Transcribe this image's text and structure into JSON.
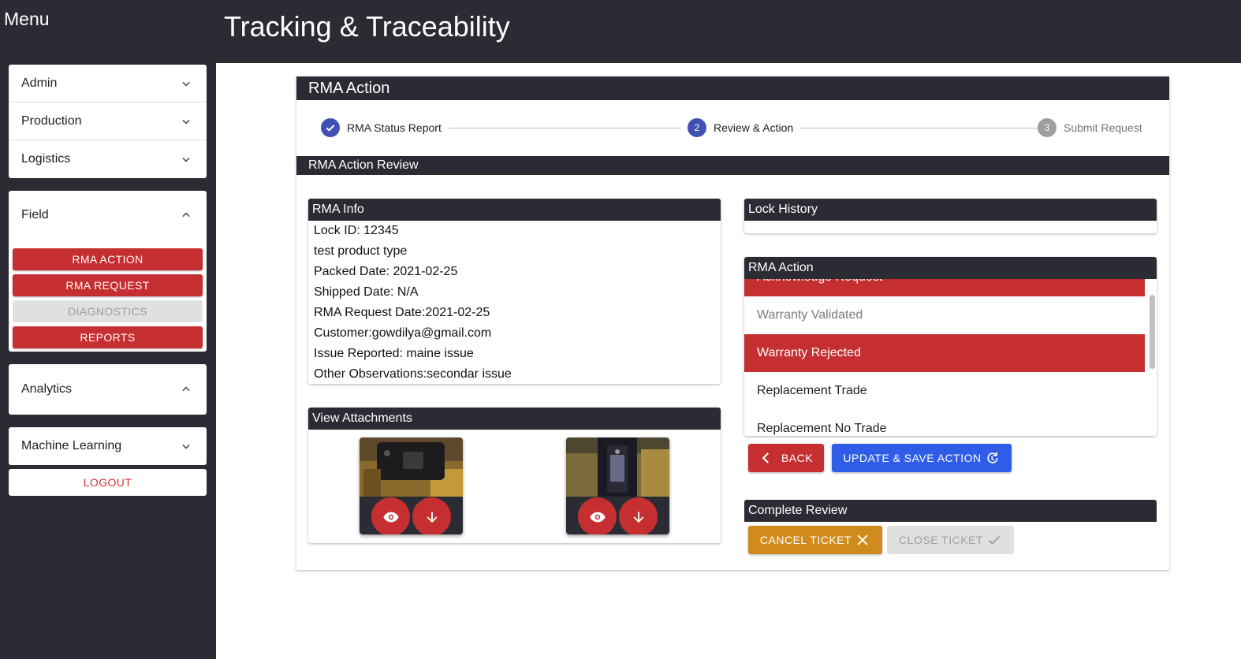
{
  "sidebar": {
    "title": "Menu",
    "groups": [
      {
        "label": "Admin"
      },
      {
        "label": "Production"
      },
      {
        "label": "Logistics"
      }
    ],
    "field": {
      "label": "Field",
      "items": [
        {
          "label": "RMA ACTION"
        },
        {
          "label": "RMA REQUEST"
        },
        {
          "label": "DIAGNOSTICS"
        },
        {
          "label": "REPORTS"
        }
      ]
    },
    "analytics": {
      "label": "Analytics"
    },
    "ml": {
      "label": "Machine Learning"
    },
    "logout": "LOGOUT"
  },
  "header": {
    "title": "Tracking & Traceability"
  },
  "panel": {
    "title": "RMA Action",
    "steps": [
      {
        "number": "1",
        "label": "RMA Status Report",
        "state": "done"
      },
      {
        "number": "2",
        "label": "Review & Action",
        "state": "active"
      },
      {
        "number": "3",
        "label": "Submit Request",
        "state": "pending"
      }
    ],
    "review_title": "RMA Action Review",
    "rma_info": {
      "title": "RMA Info",
      "lines": [
        "Lock ID: 12345",
        "test product type",
        "Packed Date: 2021-02-25",
        "Shipped Date: N/A",
        "RMA Request Date:2021-02-25",
        "Customer:gowdilya@gmail.com",
        "Issue Reported: maine issue",
        "Other Observations:secondar issue"
      ]
    },
    "attachments": {
      "title": "View Attachments"
    },
    "lock_history": {
      "title": "Lock History"
    },
    "rma_action": {
      "title": "RMA Action",
      "options": [
        {
          "label": "Acknowledge Request"
        },
        {
          "label": "Warranty Validated"
        },
        {
          "label": "Warranty Rejected"
        },
        {
          "label": "Replacement Trade"
        },
        {
          "label": "Replacement No Trade"
        }
      ],
      "back_label": "BACK",
      "update_label": "UPDATE & SAVE ACTION"
    },
    "complete_review": {
      "title": "Complete Review",
      "cancel_label": "CANCEL TICKET",
      "close_label": "CLOSE TICKET"
    }
  },
  "colors": {
    "dark": "#2b2c33",
    "accent_red": "#c62f31",
    "primary_blue": "#2f5de8",
    "step_blue": "#3f51b5",
    "warning_orange": "#d18b1d"
  }
}
